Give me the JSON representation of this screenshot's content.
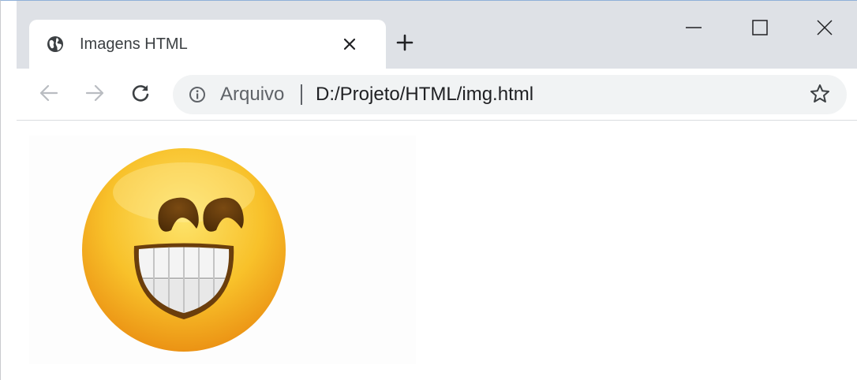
{
  "window": {
    "controls": {
      "minimize_icon": "minimize-icon",
      "maximize_icon": "maximize-icon",
      "close_icon": "close-icon"
    }
  },
  "tabs": [
    {
      "title": "Imagens HTML",
      "favicon": "globe-icon",
      "active": true
    }
  ],
  "new_tab_icon": "plus-icon",
  "toolbar": {
    "back_icon": "arrow-left-icon",
    "forward_icon": "arrow-right-icon",
    "reload_icon": "reload-icon"
  },
  "omnibox": {
    "info_icon": "info-icon",
    "scheme_label": "Arquivo",
    "url": "D:/Projeto/HTML/img.html",
    "bookmark_icon": "star-icon"
  },
  "page": {
    "image": {
      "content": "grinning-face-emoji"
    }
  },
  "colors": {
    "tabstrip_bg": "#dee1e6",
    "omnibox_bg": "#f1f3f4",
    "text_primary": "#202124",
    "text_secondary": "#5f6368",
    "emoji_yellow": "#f6b21c"
  }
}
